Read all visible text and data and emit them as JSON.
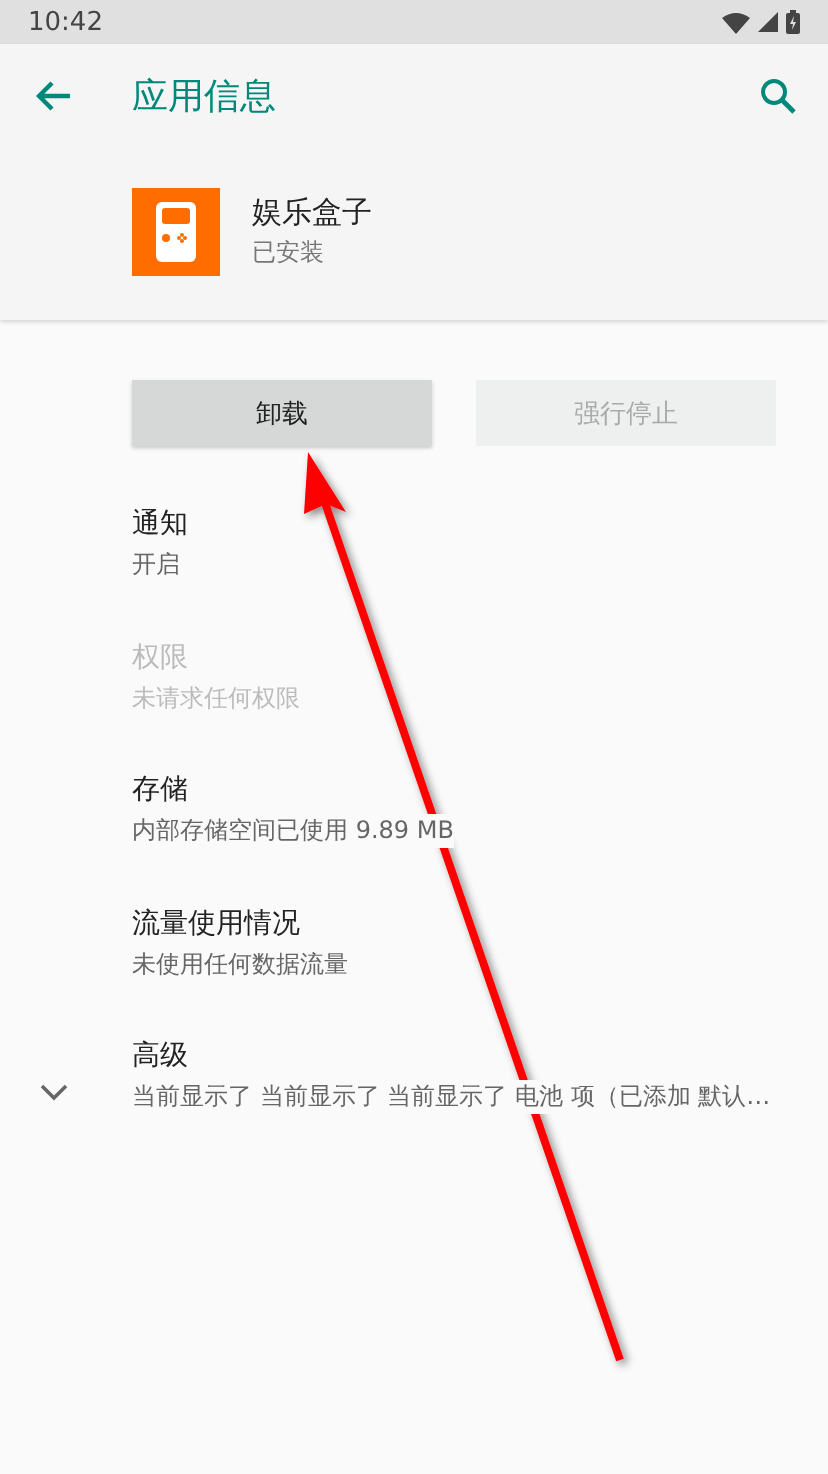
{
  "status_bar": {
    "time": "10:42"
  },
  "app_bar": {
    "title": "应用信息"
  },
  "app": {
    "name": "娱乐盒子",
    "status": "已安装"
  },
  "buttons": [
    {
      "label": "卸载",
      "disabled": false
    },
    {
      "label": "强行停止",
      "disabled": true
    }
  ],
  "items": [
    {
      "kind": "plain",
      "title": "通知",
      "summary": "开启",
      "disabled": false
    },
    {
      "kind": "plain",
      "title": "权限",
      "summary": "未请求任何权限",
      "disabled": true
    },
    {
      "kind": "plain",
      "title": "存储",
      "summary": "内部存储空间已使用 9.89 MB",
      "disabled": false
    },
    {
      "kind": "plain",
      "title": "流量使用情况",
      "summary": "未使用任何数据流量",
      "disabled": false
    },
    {
      "kind": "expandable",
      "title": "高级",
      "summary": "当前显示了 当前显示了 当前显示了 电池 项（已添加 默认…",
      "disabled": false
    }
  ]
}
